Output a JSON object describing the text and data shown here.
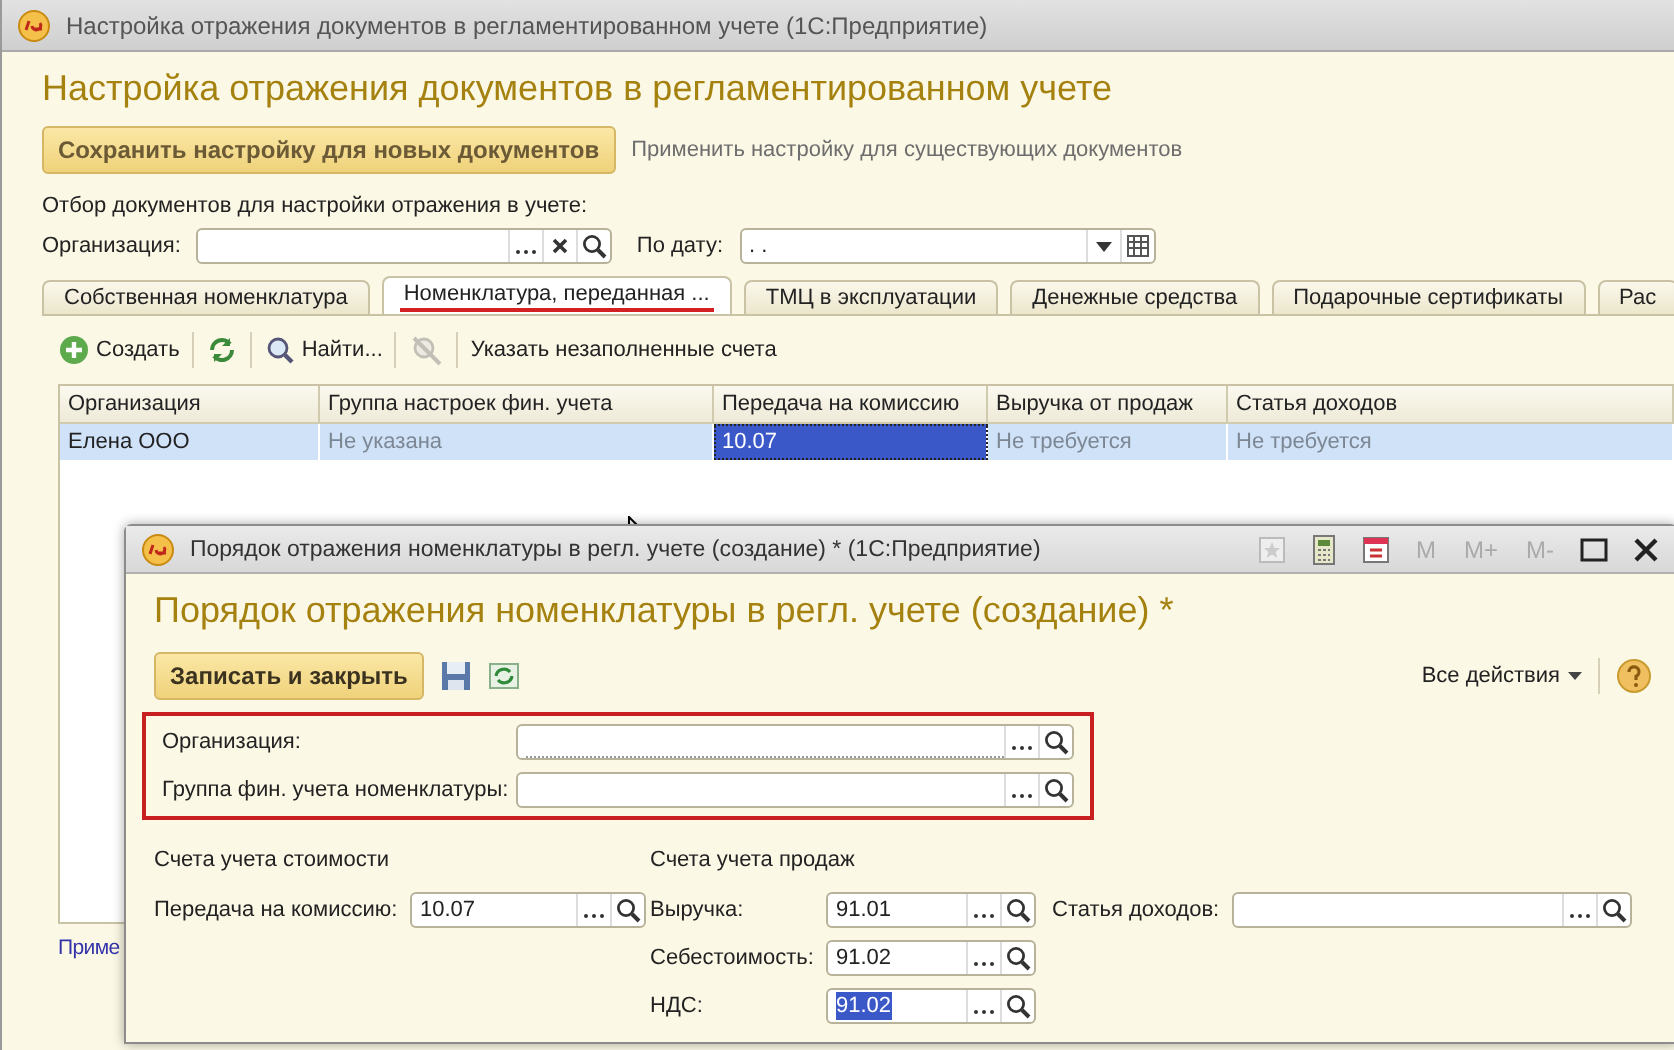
{
  "main_window": {
    "title": "Настройка отражения документов в регламентированном учете (1С:Предприятие)",
    "heading": "Настройка отражения документов в регламентированном учете",
    "actions": [
      {
        "label": "Сохранить настройку для новых документов",
        "kind": "button"
      },
      {
        "label": "Применить настройку для существующих документов",
        "kind": "link"
      }
    ],
    "filter_caption": "Отбор документов для настройки отражения в учете:",
    "filters": [
      {
        "label": "Организация:",
        "kind": "reference"
      },
      {
        "label": "По дату:",
        "value": ". .",
        "kind": "date"
      }
    ],
    "tabs": [
      {
        "label": "Собственная номенклатура",
        "selected": false
      },
      {
        "label": "Номенклатура, переданная ...",
        "selected": true
      },
      {
        "label": "ТМЦ в эксплуатации",
        "selected": false
      },
      {
        "label": "Денежные средства",
        "selected": false
      },
      {
        "label": "Подарочные сертификаты",
        "selected": false
      },
      {
        "label": "Рас",
        "selected": false
      }
    ],
    "toolbar": [
      {
        "kind": "create",
        "label": "Создать",
        "disabled": false
      },
      {
        "kind": "refresh",
        "disabled": false
      },
      {
        "kind": "find",
        "label": "Найти...",
        "disabled": false
      },
      {
        "kind": "cancel-find",
        "disabled": true
      },
      {
        "kind": "text",
        "label": "Указать незаполненные счета",
        "disabled": false
      }
    ],
    "table": {
      "columns": [
        "Организация",
        "Группа настроек фин. учета",
        "Передача на комиссию",
        "Выручка от продаж",
        "Статья доходов"
      ],
      "rows": [
        {
          "selected": true,
          "cells": [
            {
              "text": "Елена ООО",
              "greyed": false,
              "focused": false
            },
            {
              "text": "Не указана",
              "greyed": true,
              "focused": false
            },
            {
              "text": "10.07",
              "greyed": false,
              "focused": true
            },
            {
              "text": "Не требуется",
              "greyed": true,
              "focused": false
            },
            {
              "text": "Не требуется",
              "greyed": true,
              "focused": false
            }
          ]
        }
      ]
    },
    "footer_link": "Приме"
  },
  "dialog": {
    "title": "Порядок отражения номенклатуры в регл. учете (создание) * (1С:Предприятие)",
    "memory_buttons": [
      "M",
      "M+",
      "M-"
    ],
    "heading": "Порядок отражения номенклатуры в регл. учете (создание) *",
    "save_button": "Записать и закрыть",
    "all_actions": "Все действия",
    "key_fields": [
      {
        "label": "Организация:",
        "required": true
      },
      {
        "label": "Группа фин. учета номенклатуры:",
        "required": false
      }
    ],
    "cost_accounts": {
      "caption": "Счета учета стоимости",
      "fields": [
        {
          "label": "Передача на комиссию:",
          "value": "10.07",
          "selected": false
        }
      ]
    },
    "sales_accounts": {
      "caption": "Счета учета продаж",
      "fields": [
        {
          "label": "Выручка:",
          "value": "91.01",
          "selected": false
        },
        {
          "label": "Себестоимость:",
          "value": "91.02",
          "selected": false
        },
        {
          "label": "НДС:",
          "value": "91.02",
          "selected": true
        }
      ]
    },
    "income_item": {
      "label": "Статья доходов:"
    }
  }
}
